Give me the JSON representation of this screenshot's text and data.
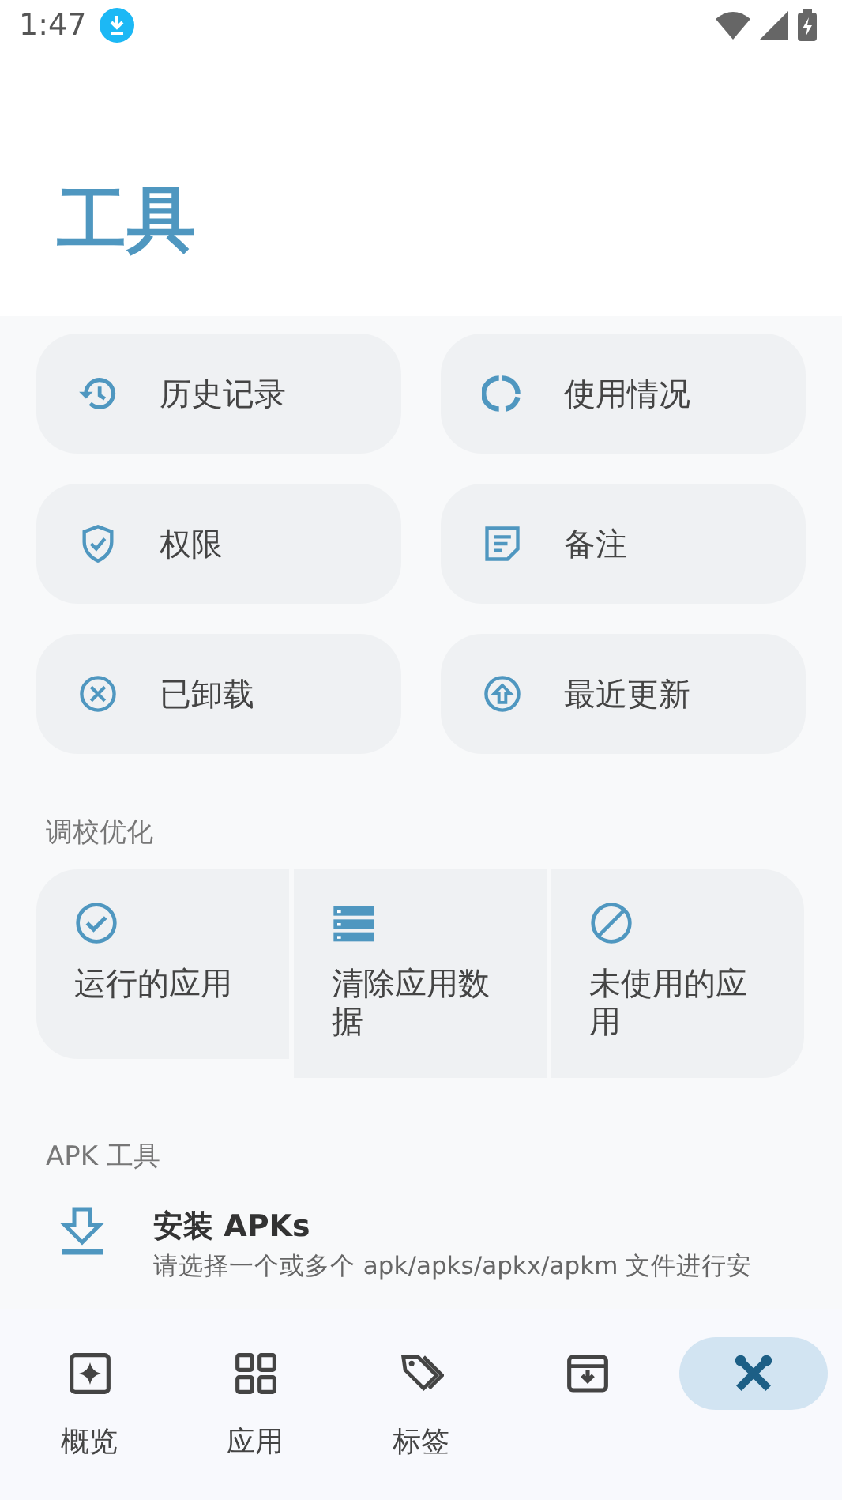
{
  "status_bar": {
    "time": "1:47"
  },
  "title": "工具",
  "tools": [
    {
      "label": "历史记录"
    },
    {
      "label": "使用情况"
    },
    {
      "label": "权限"
    },
    {
      "label": "备注"
    },
    {
      "label": "已卸载"
    },
    {
      "label": "最近更新"
    }
  ],
  "tuning": {
    "heading": "调校优化",
    "items": [
      {
        "label": "运行的应用"
      },
      {
        "label": "清除应用数据"
      },
      {
        "label": "未使用的应用"
      }
    ]
  },
  "apk_tools": {
    "heading": "APK 工具",
    "items": [
      {
        "title": "安装 APKs",
        "subtitle": "请选择一个或多个 apk/apks/apkx/apkm 文件进行安"
      }
    ]
  },
  "bottom_nav": [
    {
      "label": "概览",
      "selected": false
    },
    {
      "label": "应用",
      "selected": false
    },
    {
      "label": "标签",
      "selected": false
    },
    {
      "selected": false
    },
    {
      "selected": true
    }
  ]
}
